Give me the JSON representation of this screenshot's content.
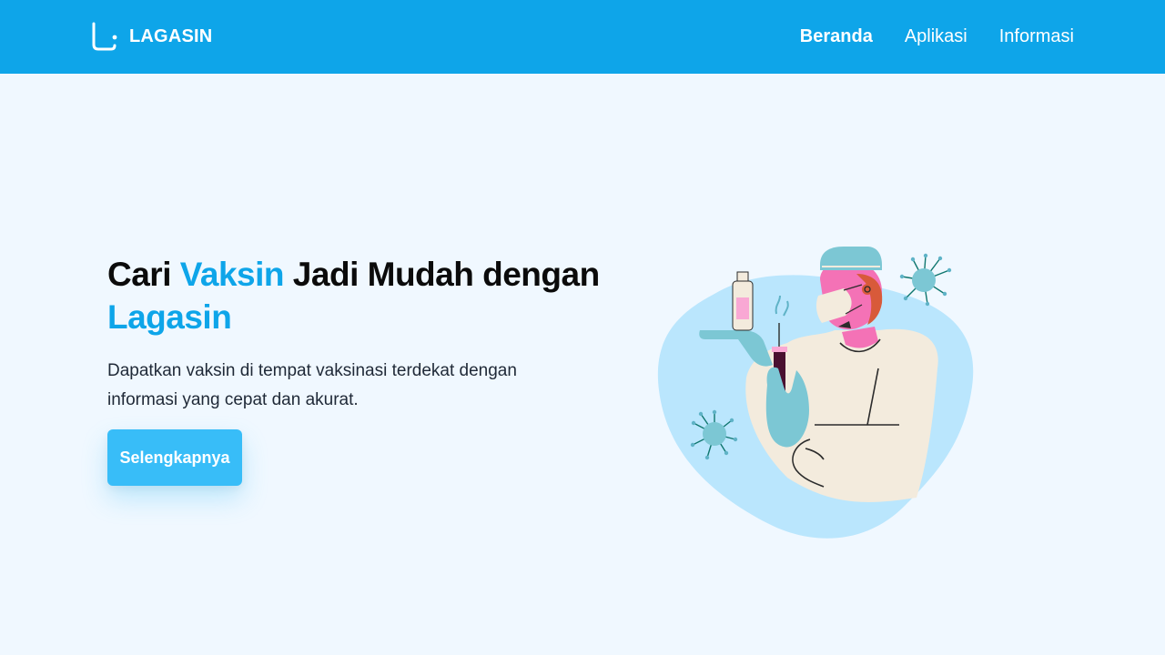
{
  "header": {
    "brand": "LAGASIN",
    "nav": [
      {
        "label": "Beranda",
        "active": true
      },
      {
        "label": "Aplikasi",
        "active": false
      },
      {
        "label": "Informasi",
        "active": false
      }
    ]
  },
  "hero": {
    "title_part1": "Cari ",
    "title_accent1": "Vaksin",
    "title_part2": " Jadi Mudah dengan ",
    "title_accent2": "Lagasin",
    "description": "Dapatkan vaksin di tempat vaksinasi terdekat dengan informasi yang cepat dan akurat.",
    "cta_label": "Selengkapnya"
  },
  "colors": {
    "primary": "#0ea5e9",
    "button": "#38bdf8",
    "background": "#f0f8ff",
    "blob": "#bae6fd"
  },
  "icons": {
    "logo": "lagasin-logo-icon",
    "illustration": "vaccine-nurse-illustration"
  }
}
